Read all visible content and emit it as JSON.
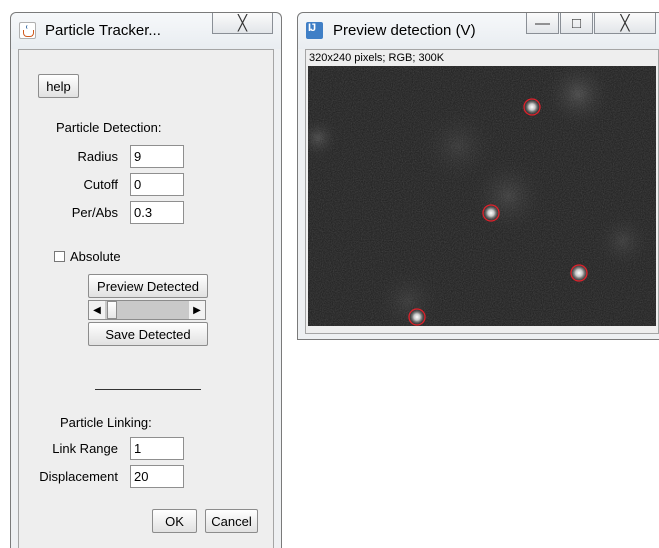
{
  "tracker": {
    "title": "Particle Tracker...",
    "close_glyph": "╳",
    "help_label": "help",
    "detection_heading": "Particle Detection:",
    "radius": {
      "label": "Radius",
      "value": "9"
    },
    "cutoff": {
      "label": "Cutoff",
      "value": "0"
    },
    "perabs": {
      "label": "Per/Abs",
      "value": "0.3"
    },
    "absolute_label": "Absolute",
    "absolute_checked": false,
    "preview_detected_label": "Preview Detected",
    "save_detected_label": "Save Detected",
    "linking_heading": "Particle Linking:",
    "link_range": {
      "label": "Link Range",
      "value": "1"
    },
    "displacement": {
      "label": "Displacement",
      "value": "20"
    },
    "ok_label": "OK",
    "cancel_label": "Cancel"
  },
  "preview": {
    "title": "Preview detection (V)",
    "minimize_glyph": "—",
    "maximize_glyph": "□",
    "close_glyph": "╳",
    "image_info": "320x240 pixels; RGB; 300K",
    "marker_color": "#e0202a"
  }
}
